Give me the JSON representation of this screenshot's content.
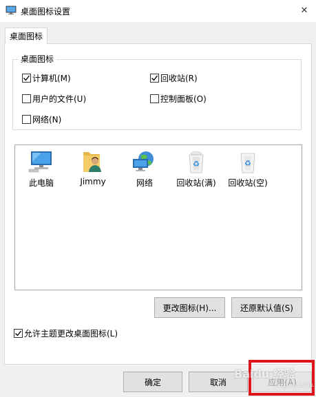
{
  "window": {
    "title": "桌面图标设置",
    "close_glyph": "✕"
  },
  "tabs": [
    {
      "label": "桌面图标",
      "selected": true
    }
  ],
  "desktop_icons_group": {
    "label": "桌面图标",
    "checkboxes": [
      {
        "label": "计算机(M)",
        "checked": true
      },
      {
        "label": "回收站(R)",
        "checked": true
      },
      {
        "label": "用户的文件(U)",
        "checked": false
      },
      {
        "label": "控制面板(O)",
        "checked": false
      },
      {
        "label": "网络(N)",
        "checked": false
      }
    ]
  },
  "icon_list": [
    {
      "label": "此电脑",
      "icon": "this-pc-icon"
    },
    {
      "label": "Jimmy",
      "icon": "user-folder-icon"
    },
    {
      "label": "网络",
      "icon": "network-icon"
    },
    {
      "label": "回收站(满)",
      "icon": "recycle-bin-full-icon"
    },
    {
      "label": "回收站(空)",
      "icon": "recycle-bin-empty-icon"
    }
  ],
  "actions": {
    "change_icon": "更改图标(H)...",
    "restore_default": "还原默认值(S)"
  },
  "allow_themes": {
    "label": "允许主题更改桌面图标(L)",
    "checked": true
  },
  "footer": {
    "ok": "确定",
    "cancel": "取消",
    "apply": "应用(A)"
  },
  "watermark": {
    "text": "Baidu 经验",
    "sub": "jingyan.baidu.com"
  },
  "colors": {
    "highlight": "#e0141c",
    "panel": "#ffffff",
    "chrome": "#f0f0f0"
  }
}
